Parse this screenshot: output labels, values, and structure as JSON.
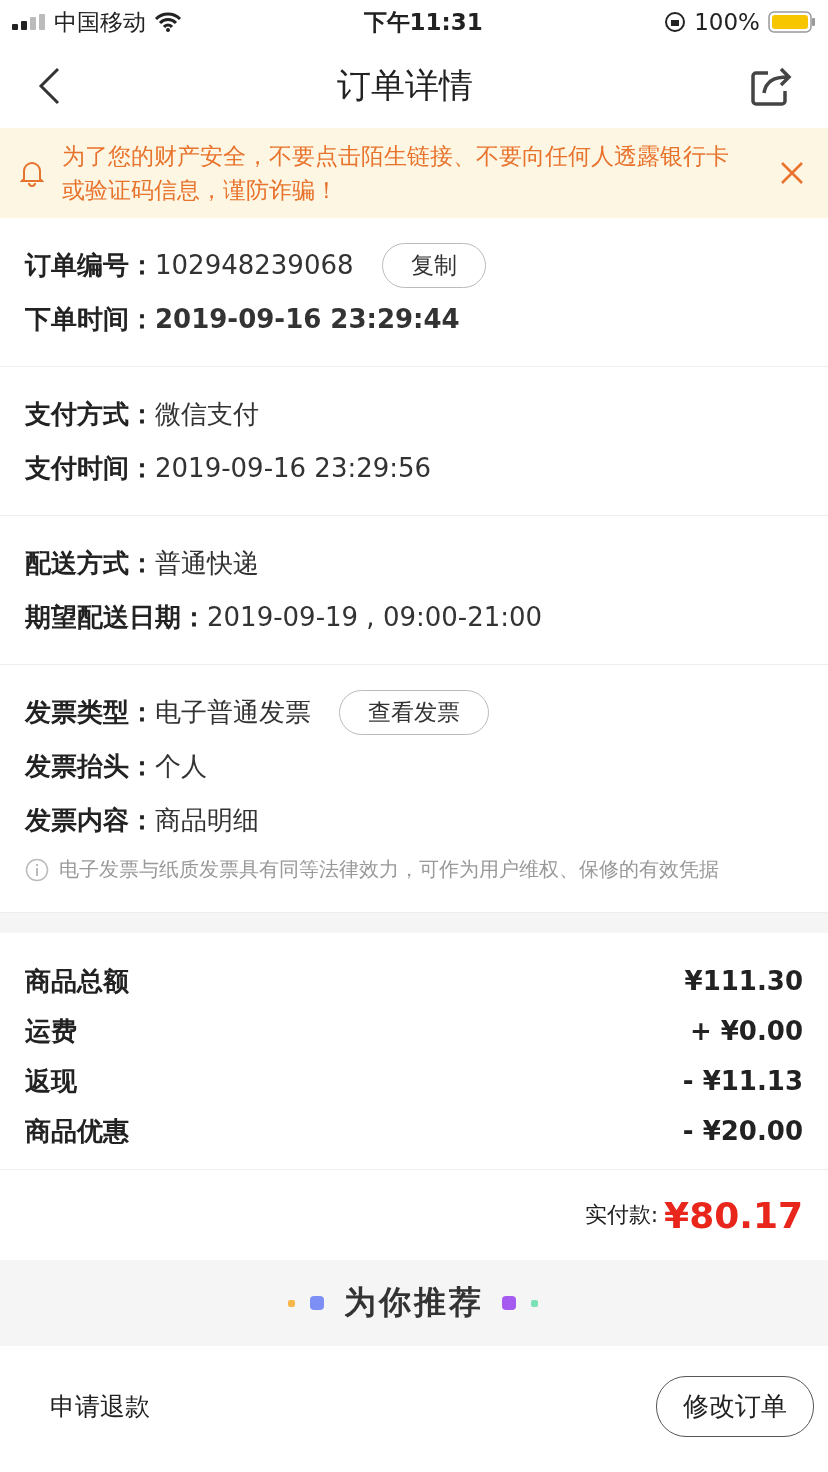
{
  "status_bar": {
    "carrier": "中国移动",
    "time": "下午11:31",
    "battery": "100%"
  },
  "nav": {
    "title": "订单详情"
  },
  "notice": {
    "text": "为了您的财产安全，不要点击陌生链接、不要向任何人透露银行卡或验证码信息，谨防诈骗！"
  },
  "sections": [
    {
      "rows": [
        {
          "label": "订单编号：",
          "value": "102948239068",
          "bold": false,
          "action": "复制"
        },
        {
          "label": "下单时间：",
          "value": "2019-09-16 23:29:44",
          "bold": true
        }
      ]
    },
    {
      "rows": [
        {
          "label": "支付方式：",
          "value": "微信支付",
          "bold": false
        },
        {
          "label": "支付时间：",
          "value": "2019-09-16 23:29:56",
          "bold": false
        }
      ]
    },
    {
      "rows": [
        {
          "label": "配送方式：",
          "value": "普通快递",
          "bold": false
        },
        {
          "label": "期望配送日期：",
          "value": "2019-09-19 , 09:00-21:00",
          "bold": false
        }
      ]
    },
    {
      "rows": [
        {
          "label": "发票类型：",
          "value": "电子普通发票",
          "bold": false,
          "action": "查看发票"
        },
        {
          "label": "发票抬头：",
          "value": "个人",
          "bold": false
        },
        {
          "label": "发票内容：",
          "value": "商品明细",
          "bold": false
        }
      ],
      "note": "电子发票与纸质发票具有同等法律效力，可作为用户维权、保修的有效凭据"
    }
  ],
  "totals": [
    {
      "label": "商品总额",
      "amount": "¥111.30"
    },
    {
      "label": "运费",
      "amount": "+ ¥0.00"
    },
    {
      "label": "返现",
      "amount": "- ¥11.13"
    },
    {
      "label": "商品优惠",
      "amount": "- ¥20.00"
    }
  ],
  "paid": {
    "label": "实付款:",
    "amount": "¥80.17"
  },
  "recommend": {
    "title": "为你推荐"
  },
  "bottom": {
    "link": "申请退款",
    "button": "修改订单"
  }
}
